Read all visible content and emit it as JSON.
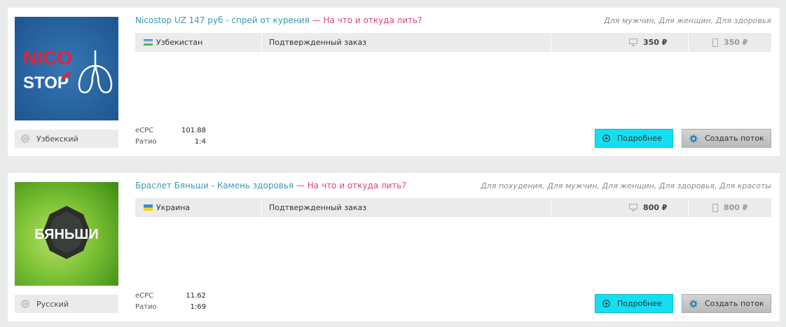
{
  "offers": [
    {
      "title": "Nicostop UZ 147 руб - спрей от курения",
      "question": " — На что и откуда лить?",
      "categories": "Для мужчин, Для женщин, Для здоровья",
      "country": "Узбекистан",
      "status": "Подтвержденный заказ",
      "price_desktop": "350 ₽",
      "price_mobile": "350 ₽",
      "language": "Узбекский",
      "ecpc_label": "eCPC",
      "ecpc": "101.88",
      "ratio_label": "Ратио",
      "ratio": "1:4",
      "image_text_1": "NICO",
      "image_text_2": "STOP",
      "more_label": "Подробнее",
      "create_label": "Создать поток"
    },
    {
      "title": "Браслет Бяньши - Камень здоровья",
      "question": " — На что и откуда лить?",
      "categories": "Для похудения, Для мужчин, Для женщин, Для здоровья, Для красоты",
      "country": "Украина",
      "status": "Подтвержденный заказ",
      "price_desktop": "800 ₽",
      "price_mobile": "800 ₽",
      "language": "Русский",
      "ecpc_label": "eCPC",
      "ecpc": "11.62",
      "ratio_label": "Ратио",
      "ratio": "1:69",
      "image_text": "БЯНЬШИ",
      "more_label": "Подробнее",
      "create_label": "Создать поток"
    }
  ],
  "colors": {
    "title": "#3a9ab3",
    "question": "#e0456b",
    "more_button": "#14def2"
  },
  "icons": [
    "globe-icon",
    "monitor-icon",
    "phone-icon",
    "plus-circle-icon",
    "gear-icon"
  ]
}
